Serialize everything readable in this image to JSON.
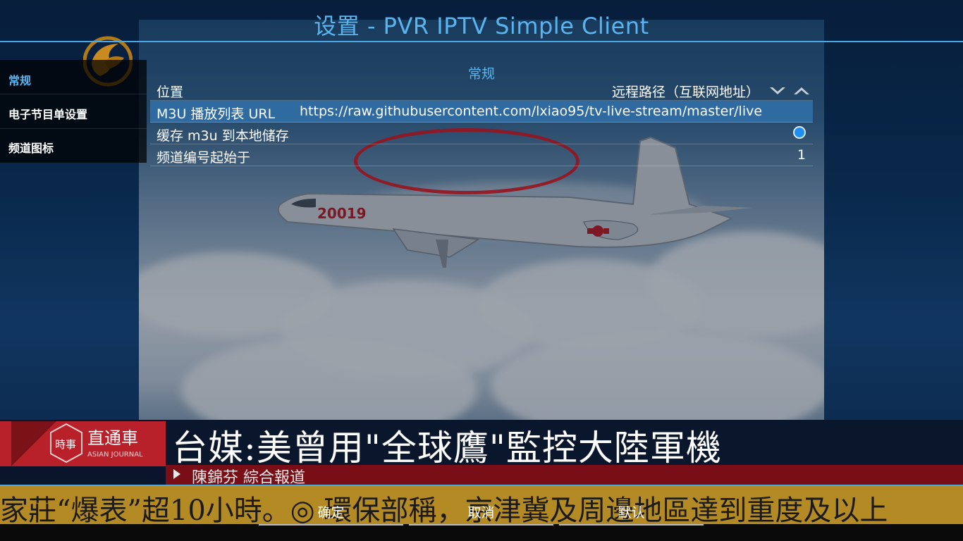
{
  "window": {
    "title": "设置 - PVR IPTV Simple Client"
  },
  "sidebar": {
    "items": [
      {
        "label": "常规",
        "selected": true
      },
      {
        "label": "电子节目单设置",
        "selected": false
      },
      {
        "label": "频道图标",
        "selected": false
      }
    ]
  },
  "panel": {
    "section_title": "常规",
    "rows": [
      {
        "label": "位置",
        "value": "远程路径（互联网地址）"
      },
      {
        "label": "M3U 播放列表 URL",
        "value": "https://raw.githubusercontent.com/lxiao95/tv-live-stream/master/live"
      },
      {
        "label": "缓存 m3u 到本地储存",
        "value_state": "on"
      },
      {
        "label": "频道编号起始于",
        "value": "1"
      }
    ]
  },
  "dialog_buttons": {
    "ok": "确定",
    "cancel": "取消",
    "defaults": "默认"
  },
  "background_video": {
    "plane_marking": "20019",
    "news_logo_small": "時事",
    "news_logo_main": "直通車",
    "news_logo_en": "ASIAN JOURNAL",
    "headline": "台媒:美曾用\"全球鷹\"監控大陸軍機",
    "subline": "陳錦芬   綜合報道",
    "ticker": "家莊“爆表”超10小時。◎ 環保部稱，京津冀及周邊地區達到重度及以上"
  },
  "colors": {
    "accent": "#5ab4f0",
    "focus_row": "#2f6aa0",
    "radio_on": "#1e8ff0",
    "news_red": "#b8202a",
    "ticker_bg": "#b48a24"
  },
  "icons": {
    "down_arrow": "chevron-down-icon",
    "up_arrow": "chevron-up-icon",
    "radio": "radio-on-icon"
  }
}
